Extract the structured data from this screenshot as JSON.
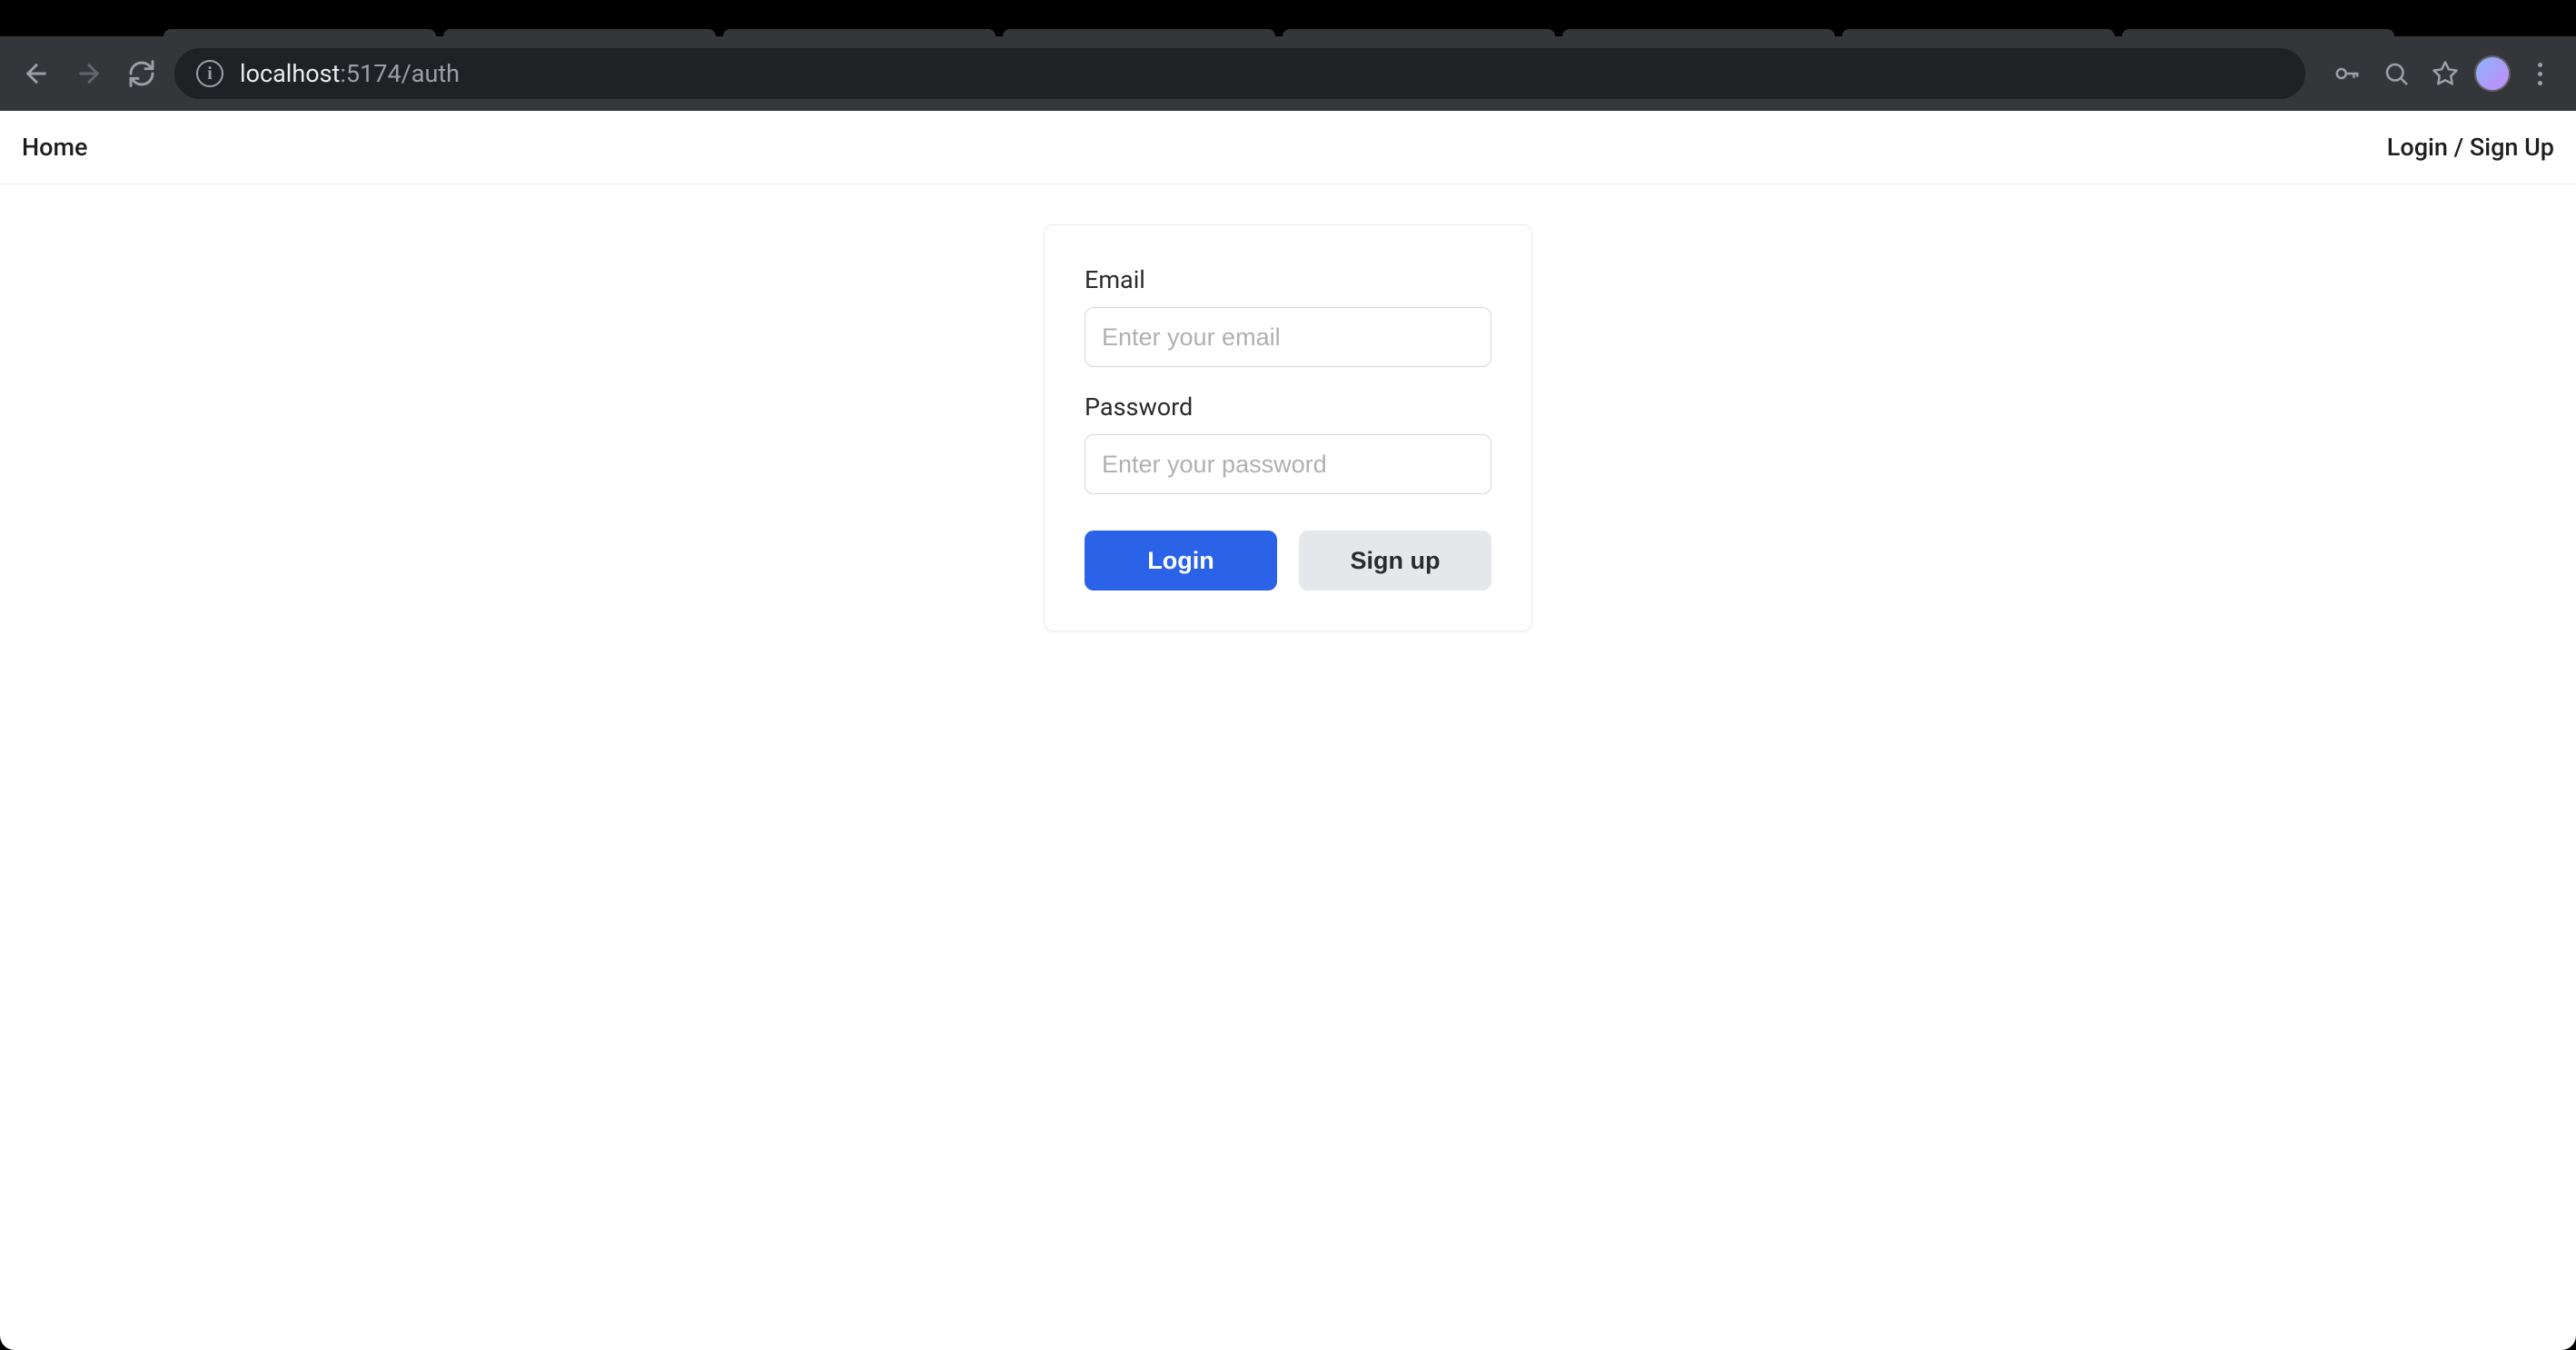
{
  "browser": {
    "url_host": "localhost",
    "url_path": ":5174/auth"
  },
  "app_header": {
    "home_link": "Home",
    "auth_link": "Login / Sign Up"
  },
  "form": {
    "email": {
      "label": "Email",
      "placeholder": "Enter your email",
      "value": ""
    },
    "password": {
      "label": "Password",
      "placeholder": "Enter your password",
      "value": ""
    },
    "buttons": {
      "login": "Login",
      "signup": "Sign up"
    }
  },
  "colors": {
    "primary": "#2a63e8",
    "secondary": "#e5e7eb"
  }
}
